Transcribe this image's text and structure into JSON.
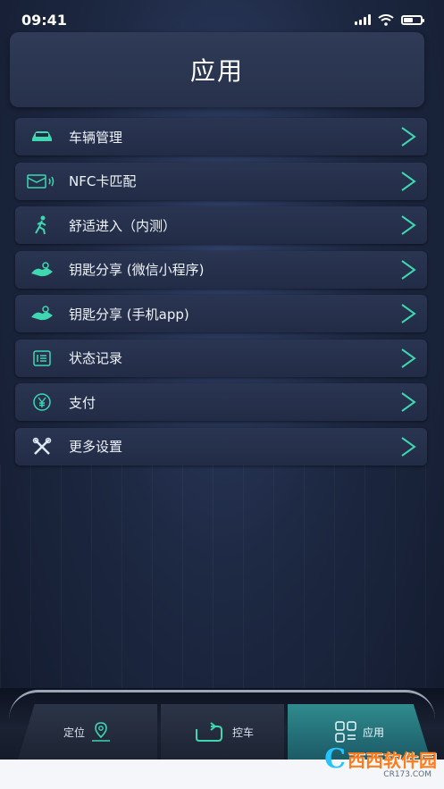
{
  "status_bar": {
    "time": "09:41"
  },
  "header": {
    "title": "应用"
  },
  "menu": [
    {
      "label": "车辆管理",
      "icon": "car-icon"
    },
    {
      "label": "NFC卡匹配",
      "icon": "nfc-card-icon"
    },
    {
      "label": "舒适进入（内测）",
      "icon": "walking-person-icon"
    },
    {
      "label": "钥匙分享 (微信小程序)",
      "icon": "key-share-icon"
    },
    {
      "label": "钥匙分享 (手机app)",
      "icon": "key-share-icon"
    },
    {
      "label": "状态记录",
      "icon": "record-icon"
    },
    {
      "label": "支付",
      "icon": "yen-payment-icon"
    },
    {
      "label": "更多设置",
      "icon": "tools-icon"
    }
  ],
  "tabs": {
    "locate": "定位",
    "control": "控车",
    "apps": "应用"
  },
  "watermark": {
    "main": "西西软件园",
    "sub": "CR173.COM"
  },
  "colors": {
    "accent": "#3fd6b0",
    "background": "#1d2842"
  }
}
